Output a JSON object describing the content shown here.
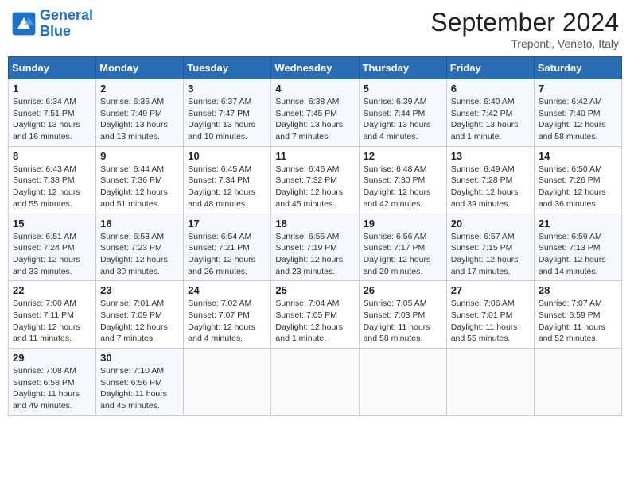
{
  "header": {
    "logo_line1": "General",
    "logo_line2": "Blue",
    "month": "September 2024",
    "location": "Treponti, Veneto, Italy"
  },
  "days_of_week": [
    "Sunday",
    "Monday",
    "Tuesday",
    "Wednesday",
    "Thursday",
    "Friday",
    "Saturday"
  ],
  "weeks": [
    [
      {
        "day": "1",
        "sunrise": "6:34 AM",
        "sunset": "7:51 PM",
        "daylight": "13 hours and 16 minutes."
      },
      {
        "day": "2",
        "sunrise": "6:36 AM",
        "sunset": "7:49 PM",
        "daylight": "13 hours and 13 minutes."
      },
      {
        "day": "3",
        "sunrise": "6:37 AM",
        "sunset": "7:47 PM",
        "daylight": "13 hours and 10 minutes."
      },
      {
        "day": "4",
        "sunrise": "6:38 AM",
        "sunset": "7:45 PM",
        "daylight": "13 hours and 7 minutes."
      },
      {
        "day": "5",
        "sunrise": "6:39 AM",
        "sunset": "7:44 PM",
        "daylight": "13 hours and 4 minutes."
      },
      {
        "day": "6",
        "sunrise": "6:40 AM",
        "sunset": "7:42 PM",
        "daylight": "13 hours and 1 minute."
      },
      {
        "day": "7",
        "sunrise": "6:42 AM",
        "sunset": "7:40 PM",
        "daylight": "12 hours and 58 minutes."
      }
    ],
    [
      {
        "day": "8",
        "sunrise": "6:43 AM",
        "sunset": "7:38 PM",
        "daylight": "12 hours and 55 minutes."
      },
      {
        "day": "9",
        "sunrise": "6:44 AM",
        "sunset": "7:36 PM",
        "daylight": "12 hours and 51 minutes."
      },
      {
        "day": "10",
        "sunrise": "6:45 AM",
        "sunset": "7:34 PM",
        "daylight": "12 hours and 48 minutes."
      },
      {
        "day": "11",
        "sunrise": "6:46 AM",
        "sunset": "7:32 PM",
        "daylight": "12 hours and 45 minutes."
      },
      {
        "day": "12",
        "sunrise": "6:48 AM",
        "sunset": "7:30 PM",
        "daylight": "12 hours and 42 minutes."
      },
      {
        "day": "13",
        "sunrise": "6:49 AM",
        "sunset": "7:28 PM",
        "daylight": "12 hours and 39 minutes."
      },
      {
        "day": "14",
        "sunrise": "6:50 AM",
        "sunset": "7:26 PM",
        "daylight": "12 hours and 36 minutes."
      }
    ],
    [
      {
        "day": "15",
        "sunrise": "6:51 AM",
        "sunset": "7:24 PM",
        "daylight": "12 hours and 33 minutes."
      },
      {
        "day": "16",
        "sunrise": "6:53 AM",
        "sunset": "7:23 PM",
        "daylight": "12 hours and 30 minutes."
      },
      {
        "day": "17",
        "sunrise": "6:54 AM",
        "sunset": "7:21 PM",
        "daylight": "12 hours and 26 minutes."
      },
      {
        "day": "18",
        "sunrise": "6:55 AM",
        "sunset": "7:19 PM",
        "daylight": "12 hours and 23 minutes."
      },
      {
        "day": "19",
        "sunrise": "6:56 AM",
        "sunset": "7:17 PM",
        "daylight": "12 hours and 20 minutes."
      },
      {
        "day": "20",
        "sunrise": "6:57 AM",
        "sunset": "7:15 PM",
        "daylight": "12 hours and 17 minutes."
      },
      {
        "day": "21",
        "sunrise": "6:59 AM",
        "sunset": "7:13 PM",
        "daylight": "12 hours and 14 minutes."
      }
    ],
    [
      {
        "day": "22",
        "sunrise": "7:00 AM",
        "sunset": "7:11 PM",
        "daylight": "12 hours and 11 minutes."
      },
      {
        "day": "23",
        "sunrise": "7:01 AM",
        "sunset": "7:09 PM",
        "daylight": "12 hours and 7 minutes."
      },
      {
        "day": "24",
        "sunrise": "7:02 AM",
        "sunset": "7:07 PM",
        "daylight": "12 hours and 4 minutes."
      },
      {
        "day": "25",
        "sunrise": "7:04 AM",
        "sunset": "7:05 PM",
        "daylight": "12 hours and 1 minute."
      },
      {
        "day": "26",
        "sunrise": "7:05 AM",
        "sunset": "7:03 PM",
        "daylight": "11 hours and 58 minutes."
      },
      {
        "day": "27",
        "sunrise": "7:06 AM",
        "sunset": "7:01 PM",
        "daylight": "11 hours and 55 minutes."
      },
      {
        "day": "28",
        "sunrise": "7:07 AM",
        "sunset": "6:59 PM",
        "daylight": "11 hours and 52 minutes."
      }
    ],
    [
      {
        "day": "29",
        "sunrise": "7:08 AM",
        "sunset": "6:58 PM",
        "daylight": "11 hours and 49 minutes."
      },
      {
        "day": "30",
        "sunrise": "7:10 AM",
        "sunset": "6:56 PM",
        "daylight": "11 hours and 45 minutes."
      },
      null,
      null,
      null,
      null,
      null
    ]
  ]
}
